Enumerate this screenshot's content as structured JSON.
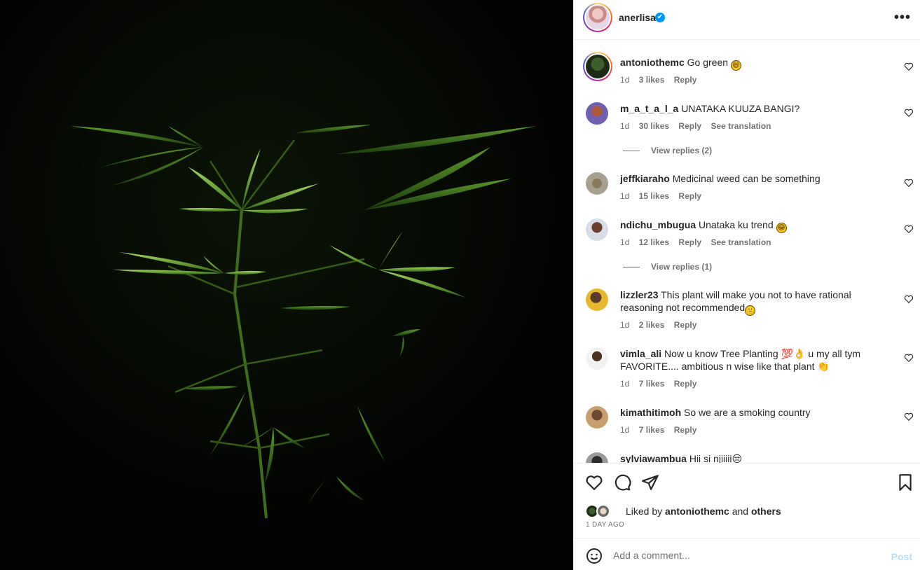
{
  "post": {
    "author": "anerlisa",
    "verified_mark": "✔",
    "more_label": "•••"
  },
  "comments": [
    {
      "user": "antoniothemc",
      "text": "Go green",
      "emoji": "😆",
      "time": "1d",
      "likes": "3 likes",
      "reply": "Reply"
    },
    {
      "user": "m_a_t_a_l_a",
      "text": "UNATAKA KUUZA BANGI?",
      "time": "1d",
      "likes": "30 likes",
      "reply": "Reply",
      "translate": "See translation",
      "view_replies": "View replies (2)"
    },
    {
      "user": "jeffkiaraho",
      "text": "Medicinal weed can be something",
      "time": "1d",
      "likes": "15 likes",
      "reply": "Reply"
    },
    {
      "user": "ndichu_mbugua",
      "text": "Unataka ku trend",
      "emoji": "😂",
      "time": "1d",
      "likes": "12 likes",
      "reply": "Reply",
      "translate": "See translation",
      "view_replies": "View replies (1)"
    },
    {
      "user": "lizzler23",
      "text": "This plant will make you not to have rational reasoning not recommended",
      "emoji": "🙁",
      "time": "1d",
      "likes": "2 likes",
      "reply": "Reply"
    },
    {
      "user": "vimla_ali",
      "text": "Now u know Tree Planting 💯👌 u my all tym FAVORITE.... ambitious n wise like that plant 👏",
      "time": "1d",
      "likes": "7 likes",
      "reply": "Reply"
    },
    {
      "user": "kimathitimoh",
      "text": "So we are a smoking country",
      "time": "1d",
      "likes": "7 likes",
      "reply": "Reply"
    },
    {
      "user": "sylviawambua",
      "text": "Hii si njiiiii😒"
    }
  ],
  "likes_bar": {
    "liked_by": "Liked by",
    "liker": "antoniothemc",
    "and": "and",
    "others": "others",
    "timestamp": "1 DAY AGO"
  },
  "composer": {
    "placeholder": "Add a comment...",
    "post_label": "Post"
  },
  "icons": [
    "heart-icon",
    "comment-icon",
    "share-icon",
    "bookmark-icon",
    "emoji-icon",
    "more-icon",
    "verified-icon"
  ],
  "colors": {
    "verified": "#0095f6",
    "post_disabled": "#b2dffc",
    "muted": "#737373",
    "leaf": "#5ea32a"
  }
}
